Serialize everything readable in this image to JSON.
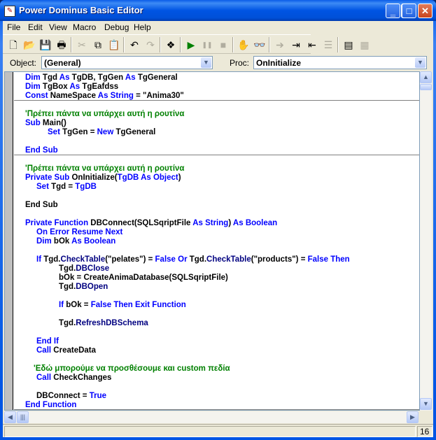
{
  "window": {
    "title": "Power Dominus Basic Editor",
    "accent": "#0054e3"
  },
  "menu": [
    "File",
    "Edit",
    "View",
    "Macro",
    "Debug",
    "Help"
  ],
  "toolbar": [
    {
      "icon": "new-icon",
      "glyph": "🗋",
      "enabled": true
    },
    {
      "icon": "open-icon",
      "glyph": "📂",
      "enabled": true
    },
    {
      "icon": "save-icon",
      "glyph": "💾",
      "enabled": true
    },
    {
      "icon": "print-icon",
      "glyph": "🖶",
      "enabled": true
    },
    {
      "icon": "cut-icon",
      "glyph": "✂",
      "enabled": false
    },
    {
      "icon": "copy-icon",
      "glyph": "⧉",
      "enabled": true
    },
    {
      "icon": "paste-icon",
      "glyph": "📋",
      "enabled": true
    },
    {
      "icon": "undo-icon",
      "glyph": "↶",
      "enabled": true
    },
    {
      "icon": "redo-icon",
      "glyph": "↷",
      "enabled": false
    },
    {
      "icon": "object-browser-icon",
      "glyph": "❖",
      "enabled": true
    },
    {
      "icon": "run-icon",
      "glyph": "▶",
      "enabled": true
    },
    {
      "icon": "pause-icon",
      "glyph": "❚❚",
      "enabled": false
    },
    {
      "icon": "stop-icon",
      "glyph": "■",
      "enabled": false
    },
    {
      "icon": "breakpoint-hand-icon",
      "glyph": "✋",
      "enabled": true
    },
    {
      "icon": "watch-glasses-icon",
      "glyph": "👓",
      "enabled": true
    },
    {
      "icon": "step-arrow-icon",
      "glyph": "➔",
      "enabled": false
    },
    {
      "icon": "indent-icon",
      "glyph": "⇥",
      "enabled": true
    },
    {
      "icon": "outdent-icon",
      "glyph": "⇤",
      "enabled": true
    },
    {
      "icon": "comment-block-icon",
      "glyph": "☰",
      "enabled": false
    },
    {
      "icon": "form-view-icon",
      "glyph": "▤",
      "enabled": true
    },
    {
      "icon": "module-icon",
      "glyph": "▦",
      "enabled": false
    }
  ],
  "selectors": {
    "object_label": "Object:",
    "object_value": "(General)",
    "proc_label": "Proc:",
    "proc_value": "OnInitialize"
  },
  "code": [
    {
      "indent": 0,
      "sep": false,
      "tokens": [
        [
          "k",
          "Dim "
        ],
        [
          "t",
          "Tgd "
        ],
        [
          "k",
          "As "
        ],
        [
          "t",
          "TgDB, TgGen "
        ],
        [
          "k",
          "As "
        ],
        [
          "t",
          "TgGeneral"
        ]
      ]
    },
    {
      "indent": 0,
      "sep": false,
      "tokens": [
        [
          "k",
          "Dim "
        ],
        [
          "t",
          "TgBox "
        ],
        [
          "k",
          "As "
        ],
        [
          "t",
          "TgEafdss"
        ]
      ]
    },
    {
      "indent": 0,
      "sep": true,
      "tokens": [
        [
          "k",
          "Const "
        ],
        [
          "t",
          "NameSpace "
        ],
        [
          "k",
          "As String "
        ],
        [
          "t",
          "= \"Anima30\""
        ]
      ]
    },
    {
      "indent": 0,
      "sep": false,
      "tokens": []
    },
    {
      "indent": 0,
      "sep": false,
      "tokens": [
        [
          "c",
          "'Πρέπει πάντα να υπάρχει αυτή η ρουτίνα"
        ]
      ]
    },
    {
      "indent": 0,
      "sep": false,
      "tokens": [
        [
          "k",
          "Sub "
        ],
        [
          "t",
          "Main()"
        ]
      ]
    },
    {
      "indent": 32,
      "sep": false,
      "tokens": [
        [
          "k",
          "Set "
        ],
        [
          "t",
          "TgGen = "
        ],
        [
          "k",
          "New "
        ],
        [
          "t",
          "TgGeneral"
        ]
      ]
    },
    {
      "indent": 0,
      "sep": false,
      "tokens": []
    },
    {
      "indent": 0,
      "sep": true,
      "tokens": [
        [
          "k",
          "End Sub"
        ]
      ]
    },
    {
      "indent": 0,
      "sep": false,
      "tokens": []
    },
    {
      "indent": 0,
      "sep": false,
      "tokens": [
        [
          "c",
          "'Πρέπει πάντα να υπάρχει αυτή η ρουτίνα"
        ]
      ]
    },
    {
      "indent": 0,
      "sep": false,
      "tokens": [
        [
          "k",
          "Private Sub "
        ],
        [
          "t",
          "OnInitialize("
        ],
        [
          "k",
          "TgDB As Object"
        ],
        [
          "t",
          ")"
        ]
      ]
    },
    {
      "indent": 16,
      "sep": false,
      "tokens": [
        [
          "k",
          "Set "
        ],
        [
          "t",
          "Tgd = "
        ],
        [
          "k",
          "TgDB"
        ]
      ]
    },
    {
      "indent": 0,
      "sep": false,
      "tokens": []
    },
    {
      "indent": 0,
      "sep": false,
      "tokens": [
        [
          "t",
          "End Sub"
        ]
      ]
    },
    {
      "indent": 0,
      "sep": false,
      "tokens": []
    },
    {
      "indent": 0,
      "sep": false,
      "tokens": [
        [
          "k",
          "Private Function "
        ],
        [
          "t",
          "DBConnect(SQLSqriptFile "
        ],
        [
          "k",
          "As String"
        ],
        [
          "t",
          ") "
        ],
        [
          "k",
          "As Boolean"
        ]
      ]
    },
    {
      "indent": 16,
      "sep": false,
      "tokens": [
        [
          "k",
          "On Error Resume Next"
        ]
      ]
    },
    {
      "indent": 16,
      "sep": false,
      "tokens": [
        [
          "k",
          "Dim "
        ],
        [
          "t",
          "bOk "
        ],
        [
          "k",
          "As Boolean"
        ]
      ]
    },
    {
      "indent": 0,
      "sep": false,
      "tokens": []
    },
    {
      "indent": 16,
      "sep": false,
      "tokens": [
        [
          "k",
          "If "
        ],
        [
          "t",
          "Tgd."
        ],
        [
          "n",
          "CheckTable"
        ],
        [
          "t",
          "(\"pelates\") = "
        ],
        [
          "k",
          "False Or "
        ],
        [
          "t",
          "Tgd."
        ],
        [
          "n",
          "CheckTable"
        ],
        [
          "t",
          "(\"products\") = "
        ],
        [
          "k",
          "False Then"
        ]
      ]
    },
    {
      "indent": 48,
      "sep": false,
      "tokens": [
        [
          "t",
          "Tgd."
        ],
        [
          "n",
          "DBClose"
        ]
      ]
    },
    {
      "indent": 48,
      "sep": false,
      "tokens": [
        [
          "t",
          "bOk = CreateAnimaDatabase(SQLSqriptFile)"
        ]
      ]
    },
    {
      "indent": 48,
      "sep": false,
      "tokens": [
        [
          "t",
          "Tgd."
        ],
        [
          "n",
          "DBOpen"
        ]
      ]
    },
    {
      "indent": 0,
      "sep": false,
      "tokens": []
    },
    {
      "indent": 48,
      "sep": false,
      "tokens": [
        [
          "k",
          "If "
        ],
        [
          "t",
          "bOk = "
        ],
        [
          "k",
          "False Then Exit Function"
        ]
      ]
    },
    {
      "indent": 0,
      "sep": false,
      "tokens": []
    },
    {
      "indent": 48,
      "sep": false,
      "tokens": [
        [
          "t",
          "Tgd."
        ],
        [
          "n",
          "RefreshDBSchema"
        ]
      ]
    },
    {
      "indent": 0,
      "sep": false,
      "tokens": []
    },
    {
      "indent": 16,
      "sep": false,
      "tokens": [
        [
          "k",
          "End If"
        ]
      ]
    },
    {
      "indent": 16,
      "sep": false,
      "tokens": [
        [
          "k",
          "Call "
        ],
        [
          "t",
          "CreateData"
        ]
      ]
    },
    {
      "indent": 0,
      "sep": false,
      "tokens": []
    },
    {
      "indent": 12,
      "sep": false,
      "tokens": [
        [
          "c",
          "'Εδώ μπορούμε να προσθέσουμε και custom πεδία"
        ]
      ]
    },
    {
      "indent": 16,
      "sep": false,
      "tokens": [
        [
          "k",
          "Call "
        ],
        [
          "t",
          "CheckChanges"
        ]
      ]
    },
    {
      "indent": 0,
      "sep": false,
      "tokens": []
    },
    {
      "indent": 16,
      "sep": false,
      "tokens": [
        [
          "t",
          "DBConnect = "
        ],
        [
          "k",
          "True"
        ]
      ]
    },
    {
      "indent": 0,
      "sep": true,
      "tokens": [
        [
          "k",
          "End Function"
        ]
      ]
    }
  ],
  "status": {
    "line_number": "16"
  }
}
